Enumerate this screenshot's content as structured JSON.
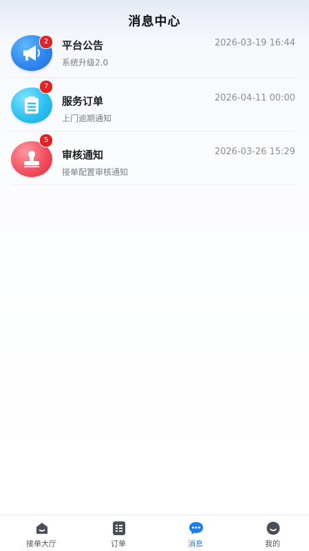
{
  "header": {
    "title": "消息中心"
  },
  "messages": [
    {
      "name": "平台公告",
      "time": "2026-03-19 16:44",
      "subtitle": "系统升级2.0",
      "badge": "2",
      "icon": "megaphone-icon",
      "color": "#2f87ee"
    },
    {
      "name": "服务订单",
      "time": "2026-04-11 00:00",
      "subtitle": "上门逾期通知",
      "badge": "7",
      "icon": "clipboard-icon",
      "color": "#2cc0f0"
    },
    {
      "name": "审核通知",
      "time": "2026-03-26 15:29",
      "subtitle": "接单配置审核通知",
      "badge": "5",
      "icon": "stamp-icon",
      "color": "#f2505f"
    }
  ],
  "tabbar": {
    "items": [
      {
        "label": "接单大厅",
        "icon": "hall-icon"
      },
      {
        "label": "订单",
        "icon": "order-list-icon"
      },
      {
        "label": "消息",
        "icon": "chat-icon",
        "active": true
      },
      {
        "label": "我的",
        "icon": "profile-icon"
      }
    ],
    "active_color": "#1b7ef0"
  }
}
